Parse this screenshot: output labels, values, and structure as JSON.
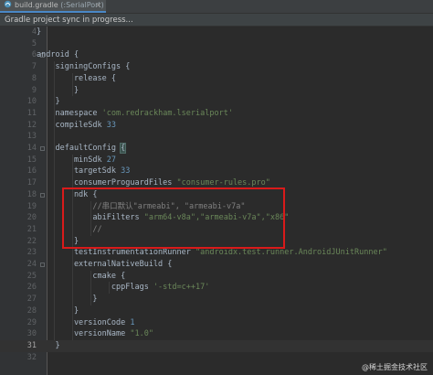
{
  "editor": {
    "tab_label": "build.gradle",
    "tab_module": "(:SerialPort)",
    "close_glyph": "×",
    "notice": "Gradle project sync in progress..."
  },
  "code_lines": [
    {
      "n": "4",
      "text": "}"
    },
    {
      "n": "5",
      "text": ""
    },
    {
      "n": "6",
      "text": "android {"
    },
    {
      "n": "7",
      "text": "    signingConfigs {"
    },
    {
      "n": "8",
      "text": "        release {"
    },
    {
      "n": "9",
      "text": "        }"
    },
    {
      "n": "10",
      "text": "    }"
    },
    {
      "n": "11",
      "text": "    namespace 'com.redrackham.lserialport'"
    },
    {
      "n": "12",
      "text": "    compileSdk 33"
    },
    {
      "n": "13",
      "text": ""
    },
    {
      "n": "14",
      "text": "    defaultConfig {"
    },
    {
      "n": "15",
      "text": "        minSdk 27"
    },
    {
      "n": "16",
      "text": "        targetSdk 33"
    },
    {
      "n": "17",
      "text": "        consumerProguardFiles \"consumer-rules.pro\""
    },
    {
      "n": "18",
      "text": "        ndk {"
    },
    {
      "n": "19",
      "text": "            //串口默认\"armeabi\", \"armeabi-v7a\""
    },
    {
      "n": "20",
      "text": "            abiFilters \"arm64-v8a\",\"armeabi-v7a\",\"x86\""
    },
    {
      "n": "21",
      "text": "            //"
    },
    {
      "n": "22",
      "text": "        }"
    },
    {
      "n": "23",
      "text": "        testInstrumentationRunner \"androidx.test.runner.AndroidJUnitRunner\""
    },
    {
      "n": "24",
      "text": "        externalNativeBuild {"
    },
    {
      "n": "25",
      "text": "            cmake {"
    },
    {
      "n": "26",
      "text": "                cppFlags '-std=c++17'"
    },
    {
      "n": "27",
      "text": "            }"
    },
    {
      "n": "28",
      "text": "        }"
    },
    {
      "n": "29",
      "text": "        versionCode 1"
    },
    {
      "n": "30",
      "text": "        versionName \"1.0\""
    },
    {
      "n": "31",
      "text": "    }"
    },
    {
      "n": "32",
      "text": ""
    }
  ],
  "watermark": "@稀土掘金技术社区",
  "colors": {
    "background": "#2b2b2b",
    "keyword": "#cc7832",
    "string": "#6a8759",
    "number": "#6897bb",
    "comment": "#808080",
    "highlight_box": "#d91a1a"
  }
}
